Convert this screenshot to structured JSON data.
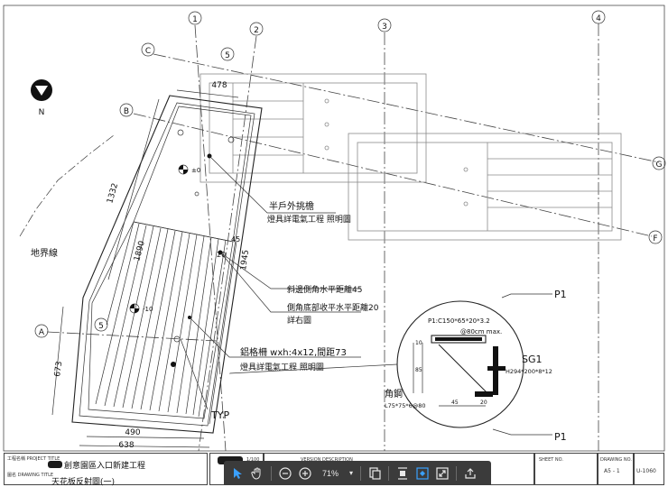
{
  "drawing": {
    "grid_labels": [
      "1",
      "2",
      "3",
      "4",
      "5",
      "5",
      "A",
      "B",
      "C",
      "F",
      "G"
    ],
    "north_label": "N",
    "boundary_label": "地界線",
    "dimensions": {
      "top_width": "478",
      "left_length": "1332",
      "mid_length": "1890",
      "right_length": "1945",
      "side_offset": "45",
      "side_offset_2": "20",
      "left_short": "673",
      "bottom_inner": "490",
      "bottom_outer": "638"
    },
    "elevations": {
      "upper": "±0",
      "lower": "-10"
    },
    "annotations": [
      "半戶外挑檐",
      "燈具詳電氣工程 照明圖",
      "斜邊側角水平距離45",
      "側角底部收平水平距離20",
      "詳右圖",
      "鋁格柵 wxh:4x12,間距73",
      "燈具詳電氣工程 照明圖",
      "TYP"
    ],
    "detail": {
      "p1_top": "P1",
      "p1_spec": "P1:C150*65*20*3.2",
      "p1_spacing": "@80cm max.",
      "sg1": "SG1",
      "sg1_spec": "H294*200*8*12",
      "angle_label": "角鋼",
      "angle_spec": "L75*75*6@80",
      "p1_bottom": "P1",
      "dims": [
        "45",
        "20",
        "10",
        "85"
      ]
    }
  },
  "title_block": {
    "project_label": "工程名稱 PROJECT TITLE",
    "project_title": "創意園區入口新建工程",
    "drawing_label": "圖名 DRAWING TITLE",
    "drawing_title": "天花板反射圖(一)",
    "scale_value": "1/100",
    "date_label": "VERSION DESCRIPTION",
    "sheet_label": "SHEET NO.",
    "drawing_no_label": "DRAWING NO.",
    "drawing_no": "A5 - 1",
    "code": "U-1060"
  },
  "toolbar": {
    "zoom_value": "71%",
    "icons": [
      "cursor-icon",
      "hand-icon",
      "zoom-out-icon",
      "zoom-in-icon",
      "copy-pages-icon",
      "fit-height-icon",
      "fit-width-icon",
      "fullscreen-icon",
      "share-icon"
    ]
  },
  "colors": {
    "toolbar_bg": "#3b3b3b",
    "active_icon": "#3aa0ff",
    "ink": "#222222"
  }
}
